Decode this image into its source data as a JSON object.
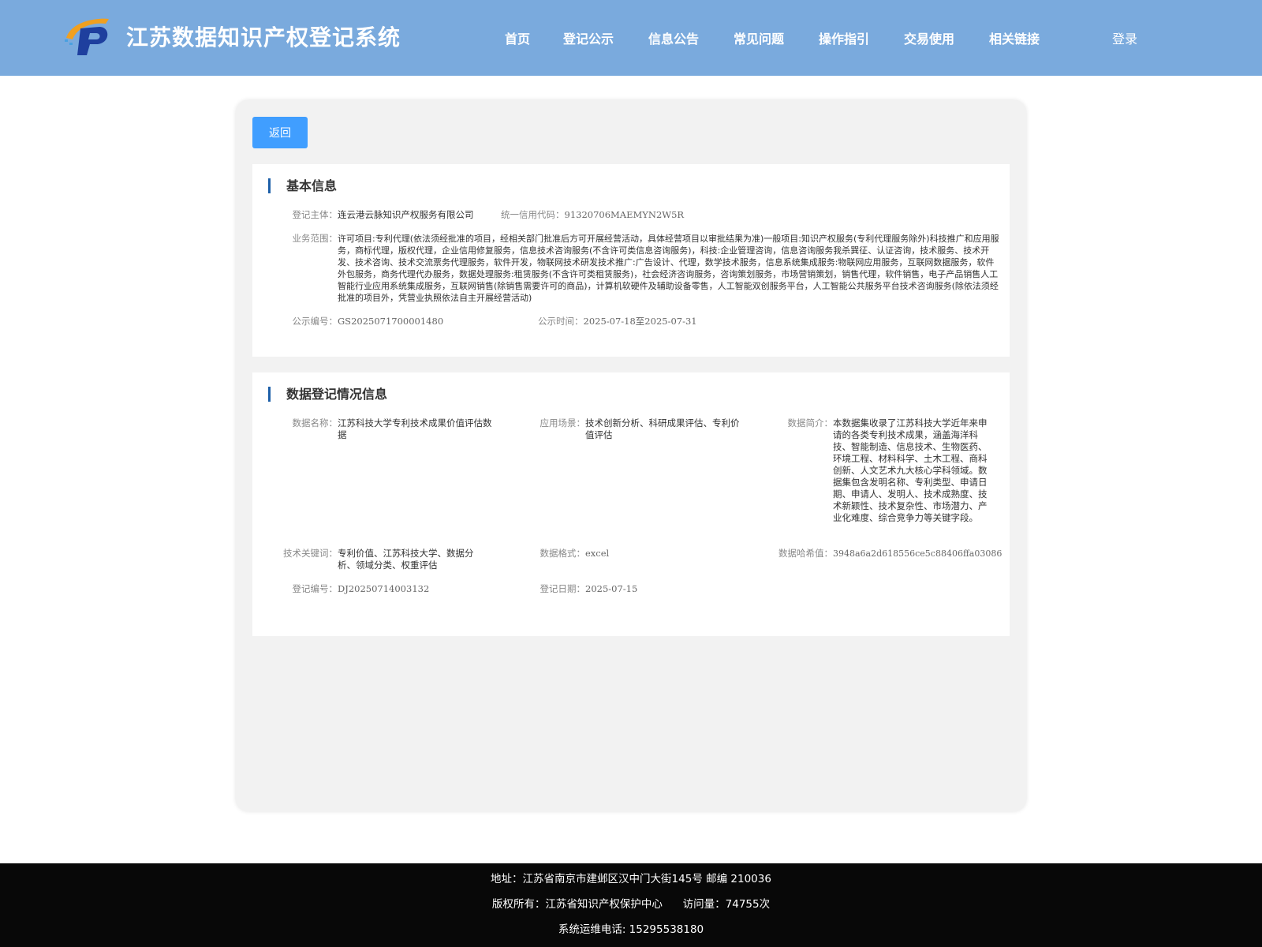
{
  "header": {
    "title": "江苏数据知识产权登记系统",
    "nav": [
      "首页",
      "登记公示",
      "信息公告",
      "常见问题",
      "操作指引",
      "交易使用",
      "相关链接"
    ],
    "login": "登录"
  },
  "back_label": "返回",
  "basic": {
    "title": "基本信息",
    "entity_label": "登记主体：",
    "entity": "连云港云脉知识产权服务有限公司",
    "credit_label": "统一信用代码：",
    "credit": "91320706MAEMYN2W5R",
    "scope_label": "业务范围：",
    "scope": "许可项目:专利代理(依法须经批准的项目，经相关部门批准后方可开展经营活动，具体经营项目以审批结果为准)一般项目:知识产权服务(专利代理服务除外)科技推广和应用服务，商标代理，版权代理，企业信用修复服务，信息技术咨询服务(不含许可类信息咨询服务)，科技:企业管理咨询，信息咨询服务我杀巽征、认证咨询，技术服务、技术开发、技术咨询、技术交流票务代理服务，软件开发，物联网技术研发技术推广:广告设计、代理，数学技术服务，信息系统集成服务:物联网应用服务，互联网数据服务，软件外包服务，商务代理代办服务，数据处理服务:租赁服务(不含许可类租赁服务)，社会经济咨询服务，咨询策划服务，市场营销策划，销售代理，软件销售，电子产品销售人工智能行业应用系统集成服务，互联网销售(除销售需要许可的商品)，计算机软硬件及辅助设备零售，人工智能双创服务平台，人工智能公共服务平台技术咨询服务(除依法须经批准的项目外，凭营业执照依法自主开展经营活动)",
    "pubno_label": "公示编号：",
    "pubno": "GS2025071700001480",
    "pubtime_label": "公示时间：",
    "pubtime": "2025-07-18至2025-07-31"
  },
  "reg": {
    "title": "数据登记情况信息",
    "name_label": "数据名称：",
    "name": "江苏科技大学专利技术成果价值评估数据",
    "scene_label": "应用场景：",
    "scene": "技术创新分析、科研成果评估、专利价值评估",
    "intro_label": "数据简介：",
    "intro": "本数据集收录了江苏科技大学近年来申请的各类专利技术成果，涵盖海洋科技、智能制造、信息技术、生物医药、环境工程、材料科学、土木工程、商科创新、人文艺术九大核心学科领域。数据集包含发明名称、专利类型、申请日期、申请人、发明人、技术成熟度、技术新颖性、技术复杂性、市场潜力、产业化难度、综合竞争力等关键字段。",
    "kw_label": "技术关键词：",
    "kw": "专利价值、江苏科技大学、数据分析、领域分类、权重评估",
    "fmt_label": "数据格式：",
    "fmt": "excel",
    "hash_label": "数据哈希值：",
    "hash": "3948a6a2d618556ce5c88406ffa03086",
    "regno_label": "登记编号：",
    "regno": "DJ20250714003132",
    "regdate_label": "登记日期：",
    "regdate": "2025-07-15"
  },
  "footer": {
    "address": "地址：江苏省南京市建邺区汉中门大街145号 邮编 210036",
    "copyright": "版权所有：江苏省知识产权保护中心      访问量：74755次",
    "phone": "系统运维电话: 15295538180"
  }
}
